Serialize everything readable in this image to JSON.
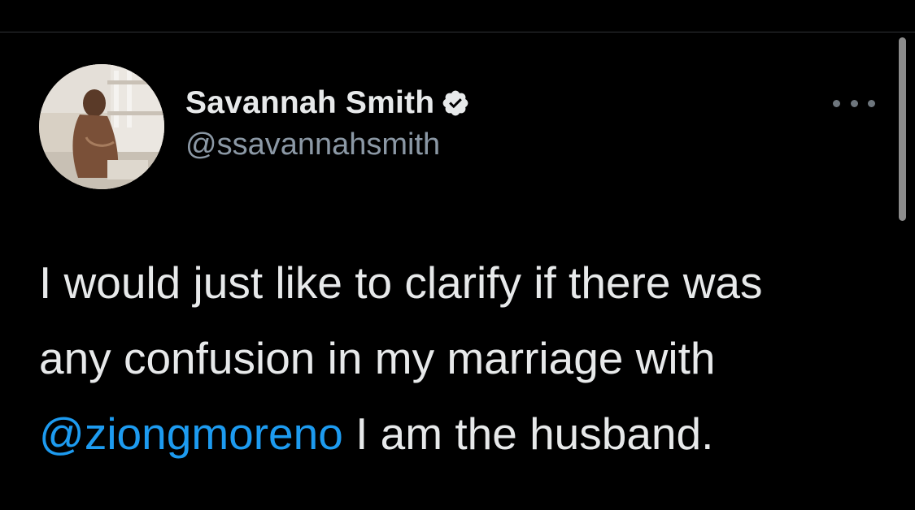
{
  "tweet": {
    "author": {
      "display_name": "Savannah Smith",
      "handle": "@ssavannahsmith",
      "verified": true,
      "verified_icon": "verified-badge-icon",
      "avatar_icon": "profile-photo"
    },
    "more_icon": "more-options-icon",
    "text": {
      "line1": "I would just like to clarify if there was",
      "line2": "any confusion in my marriage with",
      "mention": "@ziongmoreno",
      "line3_rest": " I am the husband."
    }
  },
  "colors": {
    "background": "#000000",
    "text": "#e7e9ea",
    "secondary_text": "#8b98a5",
    "link": "#1d9bf0",
    "divider": "#2f3336"
  }
}
